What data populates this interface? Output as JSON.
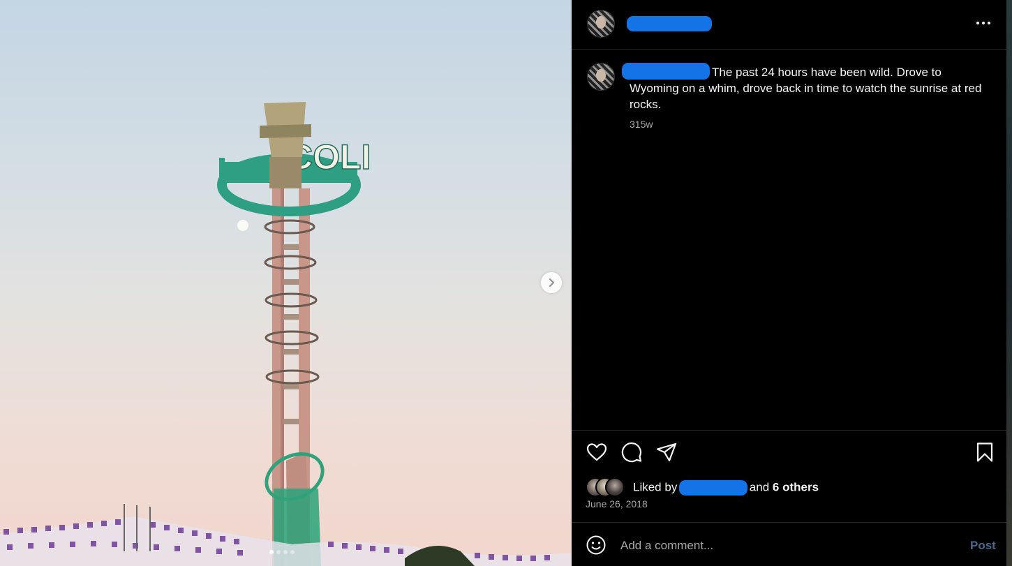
{
  "post": {
    "photo_alt": "Photo",
    "carousel": {
      "count": 4,
      "active_index": 0
    },
    "caption": "The past 24 hours have been wild. Drove to Wyoming on a whim, drove back in time to watch the sunrise at red rocks.",
    "time_ago": "315w",
    "liked_by_prefix": "Liked by",
    "liked_by_suffix_and": "and",
    "liked_by_others": "6 others",
    "date": "June 26, 2018",
    "sign_letters": "COLI"
  },
  "comment": {
    "placeholder": "Add a comment...",
    "post_label": "Post"
  },
  "icons": {
    "more": "more-icon",
    "like": "heart-icon",
    "comment": "comment-icon",
    "share": "share-icon",
    "save": "bookmark-icon",
    "emoji": "emoji-icon",
    "next": "chevron-right-icon"
  },
  "colors": {
    "redaction": "#1473e6",
    "post_button": "#4a6a90",
    "secondary_text": "#a8a8a8"
  }
}
